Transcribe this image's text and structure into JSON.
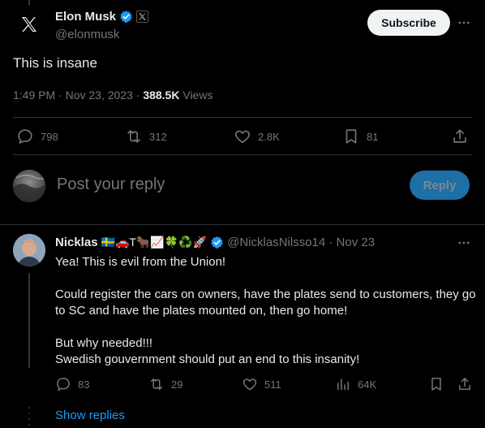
{
  "post": {
    "author_name": "Elon Musk",
    "author_handle": "@elonmusk",
    "subscribe_label": "Subscribe",
    "text": "This is insane",
    "time": "1:49 PM · Nov 23, 2023 · ",
    "views_count": "388.5K",
    "views_label": " Views",
    "stats": {
      "replies": "798",
      "reposts": "312",
      "likes": "2.8K",
      "bookmarks": "81"
    }
  },
  "composer": {
    "placeholder": "Post your reply",
    "reply_label": "Reply"
  },
  "comment": {
    "name": "Nicklas",
    "emojis": "🇸🇪🚗T🐂📈🍀♻️🚀",
    "handle_date": "@NicklasNilsso14 · Nov 23",
    "paragraphs": [
      "Yea! This is evil from the Union!",
      "Could register the cars on owners, have the plates send to customers, they go to SC and have the plates mounted on, then go home!",
      "But why needed!!!\nSwedish gouvernment should put an end to this insanity!"
    ],
    "stats": {
      "replies": "83",
      "reposts": "29",
      "likes": "511",
      "views": "64K"
    },
    "show_replies_label": "Show replies"
  },
  "colors": {
    "background": "#000000",
    "text": "#e7e9ea",
    "muted": "#71767b",
    "link": "#1d9bf0",
    "verified": "#1d9bf0",
    "reply_button": "#1d6fa5"
  },
  "icons": [
    "x-logo-icon",
    "verified-badge-icon",
    "x-affiliate-badge-icon",
    "more-icon",
    "reply-icon",
    "repost-icon",
    "like-icon",
    "bookmark-icon",
    "share-icon",
    "views-icon"
  ]
}
